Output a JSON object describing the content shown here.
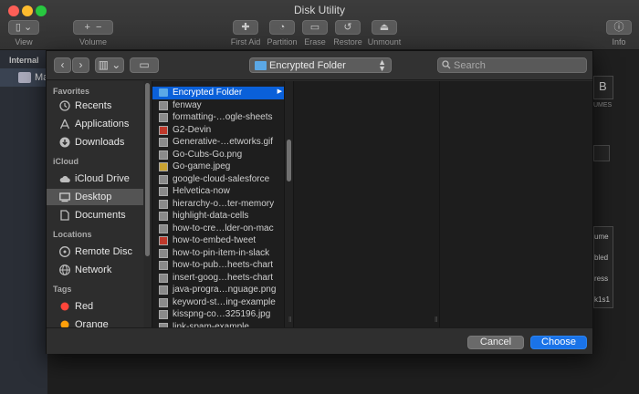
{
  "window": {
    "title": "Disk Utility",
    "toolbar": [
      {
        "label": "View"
      },
      {
        "label": "Volume"
      },
      {
        "label": "First Aid"
      },
      {
        "label": "Partition"
      },
      {
        "label": "Erase"
      },
      {
        "label": "Restore"
      },
      {
        "label": "Unmount"
      },
      {
        "label": "Info"
      }
    ],
    "sidebar": {
      "section": "Internal",
      "item_label": "Ma"
    },
    "right_fragments": [
      "B",
      "UMES",
      "ume",
      "bled",
      "ress",
      "k1s1"
    ]
  },
  "dialog": {
    "path_popup": "Encrypted Folder",
    "search": {
      "placeholder": "Search"
    },
    "sidebar": {
      "sections": [
        {
          "heading": "Favorites",
          "items": [
            {
              "label": "Recents",
              "icon": "clock-icon"
            },
            {
              "label": "Applications",
              "icon": "applications-icon"
            },
            {
              "label": "Downloads",
              "icon": "download-icon"
            }
          ]
        },
        {
          "heading": "iCloud",
          "items": [
            {
              "label": "iCloud Drive",
              "icon": "cloud-icon"
            },
            {
              "label": "Desktop",
              "icon": "desktop-icon",
              "selected": true
            },
            {
              "label": "Documents",
              "icon": "document-icon"
            }
          ]
        },
        {
          "heading": "Locations",
          "items": [
            {
              "label": "Remote Disc",
              "icon": "disc-icon"
            },
            {
              "label": "Network",
              "icon": "globe-icon"
            }
          ]
        },
        {
          "heading": "Tags",
          "items": [
            {
              "label": "Red",
              "icon": "tag-dot-icon",
              "color": "#ff453a"
            },
            {
              "label": "Orange",
              "icon": "tag-dot-icon",
              "color": "#ff9f0a"
            }
          ]
        }
      ]
    },
    "files": [
      {
        "name": "Encrypted Folder",
        "kind": "folder",
        "selected": true
      },
      {
        "name": "fenway",
        "kind": "image"
      },
      {
        "name": "formatting-…ogle-sheets",
        "kind": "image"
      },
      {
        "name": "G2-Devin",
        "kind": "image-red"
      },
      {
        "name": "Generative-…etworks.gif",
        "kind": "image"
      },
      {
        "name": "Go-Cubs-Go.png",
        "kind": "image"
      },
      {
        "name": "Go-game.jpeg",
        "kind": "image-yellow"
      },
      {
        "name": "google-cloud-salesforce",
        "kind": "image"
      },
      {
        "name": "Helvetica-now",
        "kind": "image"
      },
      {
        "name": "hierarchy-o…ter-memory",
        "kind": "image"
      },
      {
        "name": "highlight-data-cells",
        "kind": "image"
      },
      {
        "name": "how-to-cre…lder-on-mac",
        "kind": "image"
      },
      {
        "name": "how-to-embed-tweet",
        "kind": "image-red"
      },
      {
        "name": "how-to-pin-item-in-slack",
        "kind": "image"
      },
      {
        "name": "how-to-pub…heets-chart",
        "kind": "image"
      },
      {
        "name": "insert-goog…heets-chart",
        "kind": "image"
      },
      {
        "name": "java-progra…nguage.png",
        "kind": "image"
      },
      {
        "name": "keyword-st…ing-example",
        "kind": "image"
      },
      {
        "name": "kisspng-co…325196.jpg",
        "kind": "image"
      },
      {
        "name": "link-spam-example",
        "kind": "image"
      }
    ],
    "buttons": {
      "cancel": "Cancel",
      "choose": "Choose"
    }
  },
  "colors": {
    "accent": "#0a60d9",
    "choose_button": "#1a73e8",
    "folder": "#5ba8e6"
  }
}
